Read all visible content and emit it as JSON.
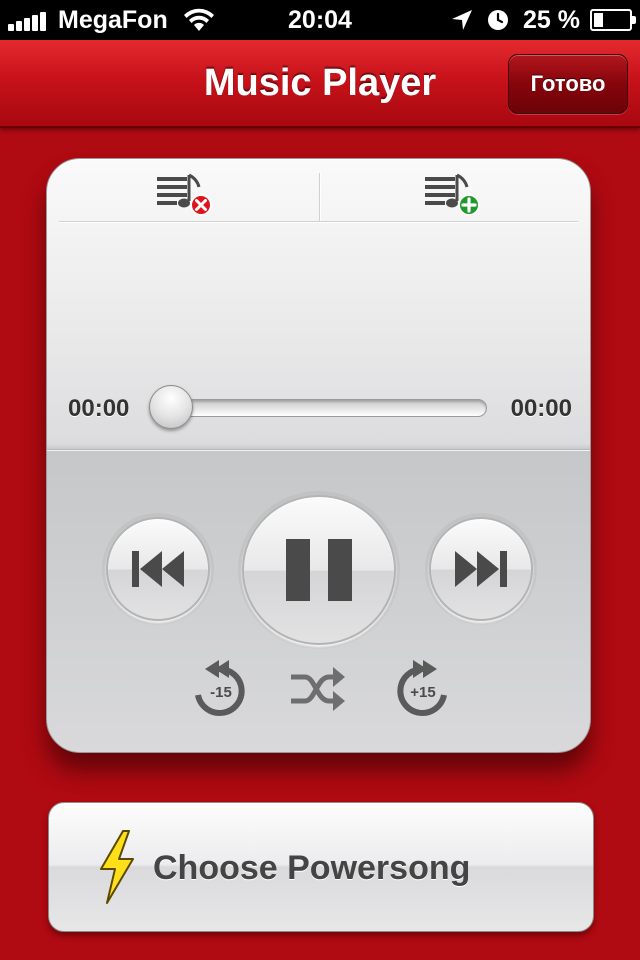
{
  "status_bar": {
    "carrier": "MegaFon",
    "time": "20:04",
    "battery_percent": "25 %",
    "battery_level": 0.25
  },
  "nav": {
    "title": "Music Player",
    "done_label": "Готово"
  },
  "player": {
    "elapsed": "00:00",
    "total": "00:00",
    "progress": 0,
    "rewind_label": "-15",
    "forward_label": "+15"
  },
  "powersong": {
    "label": "Choose Powersong"
  },
  "colors": {
    "brand_red": "#b00a12",
    "remove_badge": "#e0141c",
    "add_badge": "#1e9a2a",
    "bolt_yellow": "#ffdf1a"
  },
  "icons": {
    "playlist_remove": "playlist-remove-icon",
    "playlist_add": "playlist-add-icon",
    "previous": "skip-back-icon",
    "pause": "pause-icon",
    "next": "skip-forward-icon",
    "rewind": "rewind-15-icon",
    "shuffle": "shuffle-icon",
    "forward": "forward-15-icon",
    "powersong": "lightning-bolt-icon"
  }
}
